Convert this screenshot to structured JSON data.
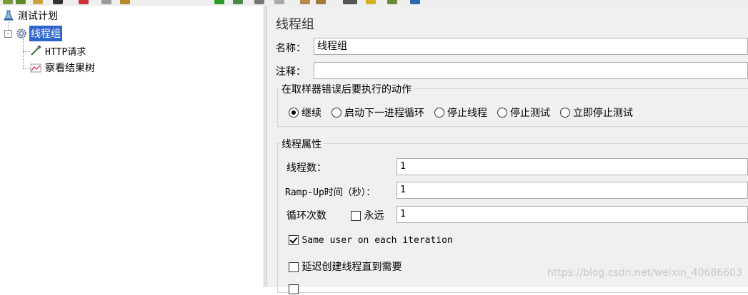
{
  "tree": {
    "items": [
      {
        "label": "测试计划",
        "icon": "test-plan-icon"
      },
      {
        "label": "线程组",
        "icon": "thread-group-gear-icon",
        "selected": true,
        "expander": "-"
      },
      {
        "label": "HTTP请求",
        "icon": "sampler-pipette-icon"
      },
      {
        "label": "察看结果树",
        "icon": "listener-graph-icon"
      }
    ]
  },
  "panel": {
    "title": "线程组",
    "name_label": "名称：",
    "name_value": "线程组",
    "comment_label": "注释：",
    "comment_value": "",
    "error_action": {
      "title": "在取样器错误后要执行的动作",
      "options": [
        "继续",
        "启动下一进程循环",
        "停止线程",
        "停止测试",
        "立即停止测试"
      ],
      "selected_index": 0
    },
    "thread_props": {
      "title": "线程属性",
      "num_threads_label": "线程数：",
      "num_threads_value": "1",
      "rampup_label": "Ramp-Up时间（秒）：",
      "rampup_value": "1",
      "loop_label": "循环次数",
      "forever_label": "永远",
      "forever_checked": false,
      "loop_value": "1",
      "same_user_label": "Same user on each iteration",
      "same_user_checked": true,
      "delay_label": "延迟创建线程直到需要",
      "delay_checked": false
    }
  },
  "watermark": "https://blog.csdn.net/weixin_40686603",
  "colors": {
    "selection": "#2f65ca",
    "panel_bg": "#f0f0f0"
  }
}
